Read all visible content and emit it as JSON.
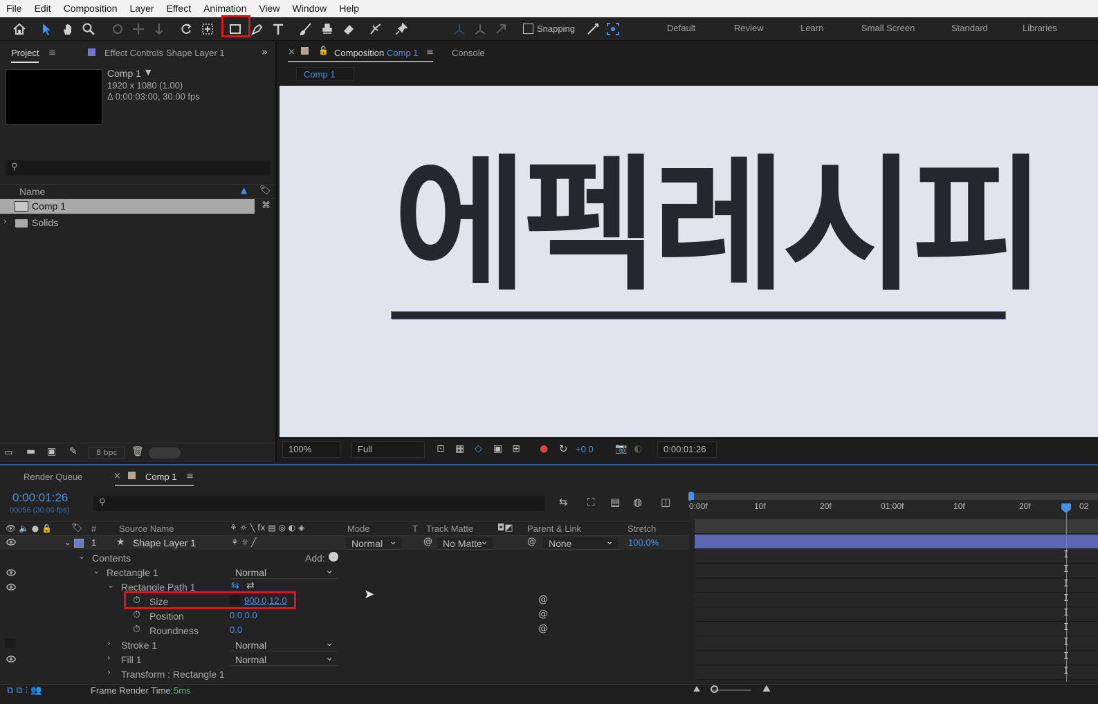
{
  "menubar": {
    "items": [
      "File",
      "Edit",
      "Composition",
      "Layer",
      "Effect",
      "Animation",
      "View",
      "Window",
      "Help"
    ]
  },
  "toolbar": {
    "snapping_label": "Snapping",
    "workspaces": [
      "Default",
      "Review",
      "Learn",
      "Small Screen",
      "Standard",
      "Libraries"
    ]
  },
  "project": {
    "tab_project": "Project",
    "tab_effect_controls": "Effect Controls",
    "effect_controls_target": "Shape Layer 1",
    "comp_name": "Comp 1",
    "comp_res": "1920 x 1080 (1.00)",
    "comp_duration": "Δ 0:00:03:00, 30.00 fps",
    "column_name": "Name",
    "items": [
      {
        "name": "Comp 1"
      },
      {
        "name": "Solids"
      }
    ],
    "bpc": "8 bpc"
  },
  "viewer": {
    "tab_composition": "Composition",
    "comp_tab_name": "Comp 1",
    "tab_console": "Console",
    "breadcrumb": "Comp 1",
    "canvas_text": "에펙레시피",
    "zoom": "100%",
    "resolution": "Full",
    "exposure": "+0.0",
    "timecode": "0:00:01:26"
  },
  "timeline": {
    "tab_render_queue": "Render Queue",
    "tab_comp": "Comp 1",
    "current_time": "0:00:01:26",
    "frame_info": "00056 (30.00 fps)",
    "columns": {
      "num": "#",
      "source_name": "Source Name",
      "mode": "Mode",
      "t": "T",
      "track_matte": "Track Matte",
      "parent_link": "Parent & Link",
      "stretch": "Stretch"
    },
    "layer": {
      "index": "1",
      "name": "Shape Layer 1",
      "mode": "Normal",
      "track_matte": "No Matte",
      "parent": "None",
      "stretch": "100.0%"
    },
    "contents_label": "Contents",
    "add_label": "Add:",
    "rectangle": {
      "label": "Rectangle 1",
      "mode": "Normal"
    },
    "rect_path": {
      "label": "Rectangle Path 1"
    },
    "size": {
      "label": "Size",
      "value": "900.0,12.0"
    },
    "position": {
      "label": "Position",
      "value": "0.0,0.0"
    },
    "roundness": {
      "label": "Roundness",
      "value": "0.0"
    },
    "stroke": {
      "label": "Stroke 1",
      "mode": "Normal"
    },
    "fill": {
      "label": "Fill 1",
      "mode": "Normal"
    },
    "transform": {
      "label": "Transform : Rectangle 1"
    },
    "ruler": [
      "0:00f",
      "10f",
      "20f",
      "01:00f",
      "10f",
      "20f",
      "02"
    ],
    "frame_render_label": "Frame Render Time:",
    "frame_render_value": "5ms"
  },
  "colors": {
    "accent_blue": "#4a90e2",
    "highlight_red": "#e5121b",
    "layer_bar": "#5d66b0",
    "canvas_bg": "#e1e4ea",
    "text_dark": "#25272c"
  }
}
